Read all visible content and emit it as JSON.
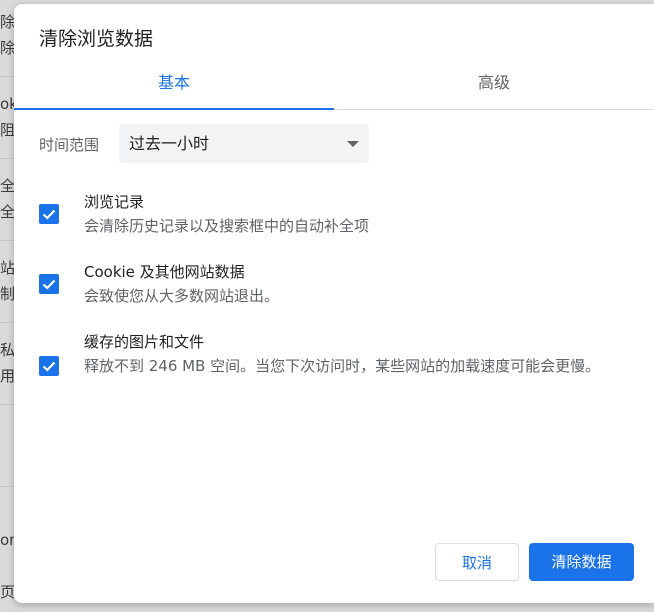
{
  "background": {
    "rows": [
      "除",
      "除",
      "ok",
      "阻",
      "全",
      "全",
      "站",
      "制",
      "私",
      "用",
      "on",
      "页"
    ]
  },
  "dialog": {
    "title": "清除浏览数据",
    "tabs": [
      {
        "label": "基本",
        "active": true
      },
      {
        "label": "高级",
        "active": false
      }
    ],
    "time_range": {
      "label": "时间范围",
      "selected": "过去一小时"
    },
    "options": [
      {
        "title": "浏览记录",
        "description": "会清除历史记录以及搜索框中的自动补全项",
        "checked": true
      },
      {
        "title": "Cookie 及其他网站数据",
        "description": "会致使您从大多数网站退出。",
        "checked": true
      },
      {
        "title": "缓存的图片和文件",
        "description": "释放不到 246 MB 空间。当您下次访问时，某些网站的加载速度可能会更慢。",
        "checked": true
      }
    ],
    "buttons": {
      "cancel": "取消",
      "confirm": "清除数据"
    }
  },
  "colors": {
    "accent": "#1a73e8",
    "text_primary": "#202124",
    "text_secondary": "#5f6368",
    "select_bg": "#f1f3f4"
  }
}
